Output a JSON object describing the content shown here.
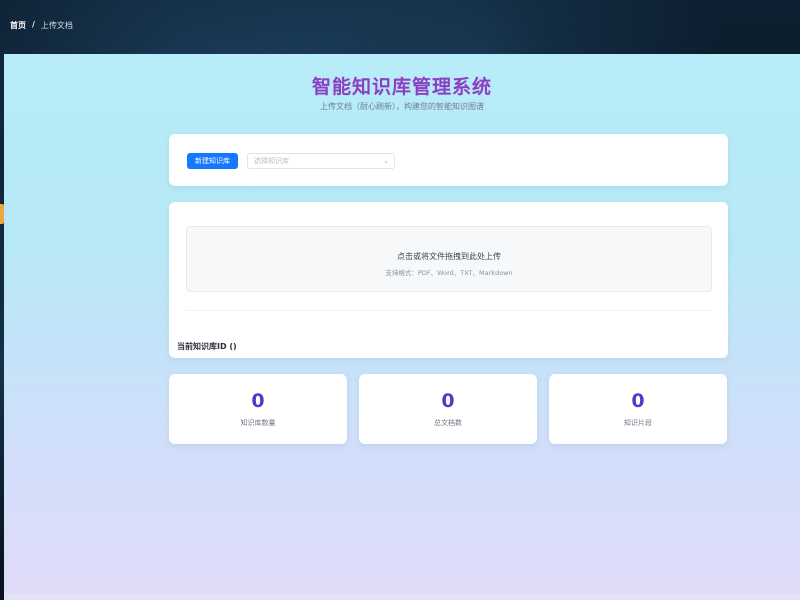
{
  "breadcrumb": {
    "home": "首页",
    "separator": "/",
    "current": "上传文档"
  },
  "header": {
    "title": "智能知识库管理系统",
    "subtitle": "上传文档（耐心刷新），构建您的智能知识图谱"
  },
  "toolbar": {
    "new_kb_label": "新建知识库",
    "select_placeholder": "选择知识库"
  },
  "upload": {
    "main_text": "点击或将文件拖拽到此处上传",
    "hint_text": "支持格式：PDF、Word、TXT、Markdown",
    "current_kb_label": "当前知识库ID ()"
  },
  "stats": [
    {
      "value": "0",
      "label": "知识库数量"
    },
    {
      "value": "0",
      "label": "总文档数"
    },
    {
      "value": "0",
      "label": "知识片段"
    }
  ],
  "colors": {
    "title": "#8b3fc2",
    "primary_button": "#1677ff",
    "stat_number": "#4a3fc4",
    "accent_tab": "#f0a640"
  }
}
